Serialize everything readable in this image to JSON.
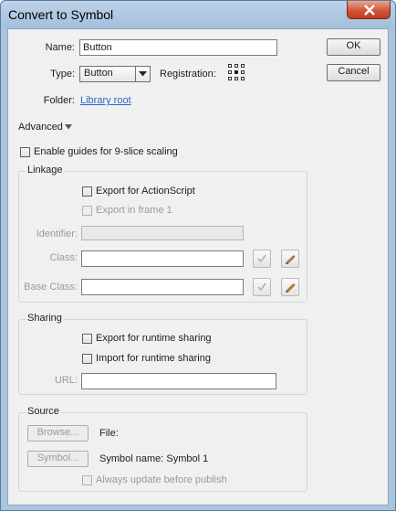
{
  "window": {
    "title": "Convert to Symbol"
  },
  "buttons": {
    "ok": "OK",
    "cancel": "Cancel"
  },
  "name": {
    "label": "Name:",
    "value": "Button"
  },
  "type": {
    "label": "Type:",
    "value": "Button"
  },
  "registration": {
    "label": "Registration:"
  },
  "folder": {
    "label": "Folder:",
    "value": "Library root"
  },
  "advanced": {
    "label": "Advanced"
  },
  "nine_slice": {
    "label": "Enable guides for 9-slice scaling",
    "checked": false
  },
  "linkage": {
    "title": "Linkage",
    "export_as": {
      "label": "Export for ActionScript",
      "checked": false
    },
    "export_frame1": {
      "label": "Export in frame 1",
      "checked": false
    },
    "identifier_label": "Identifier:",
    "identifier_value": "",
    "class_label": "Class:",
    "class_value": "",
    "base_class_label": "Base Class:",
    "base_class_value": ""
  },
  "sharing": {
    "title": "Sharing",
    "export_runtime": {
      "label": "Export for runtime sharing",
      "checked": false
    },
    "import_runtime": {
      "label": "Import for runtime sharing",
      "checked": false
    },
    "url_label": "URL:",
    "url_value": ""
  },
  "source": {
    "title": "Source",
    "browse": "Browse...",
    "file_label": "File:",
    "symbol": "Symbol...",
    "symbol_name": "Symbol name: Symbol 1",
    "always_update": {
      "label": "Always update before publish",
      "checked": false
    }
  },
  "colors": {
    "titlebar": "#a9c4df",
    "close": "#c94a2e",
    "link": "#2867c5",
    "dialog_bg": "#f0f0f0"
  },
  "icons": [
    "close-icon",
    "dropdown-arrow-icon",
    "registration-grid-icon",
    "advanced-arrow-icon",
    "validate-check-icon",
    "edit-pencil-icon"
  ]
}
